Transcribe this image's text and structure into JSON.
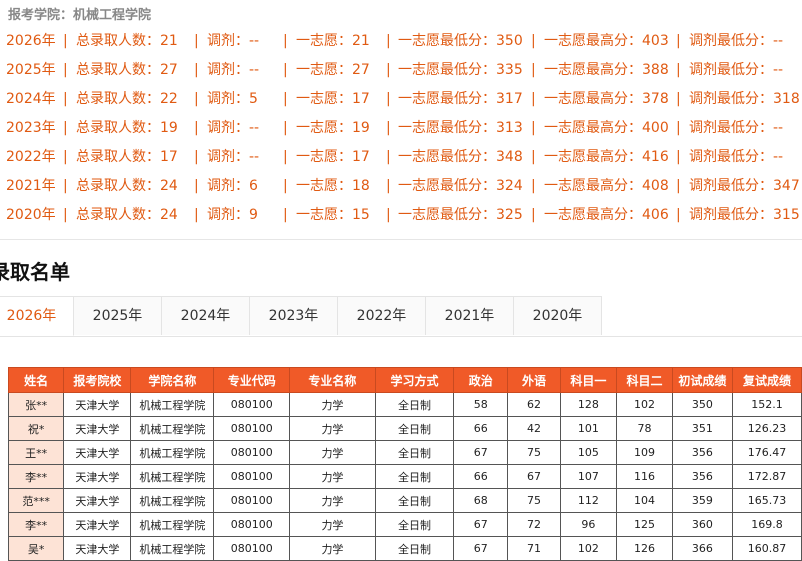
{
  "header": {
    "college_label": "报考学院：机械工程学院"
  },
  "stats_rows": [
    {
      "year": "2026年",
      "total": "总录取人数：21",
      "adjust": "调剂：--",
      "first": "一志愿：21",
      "first_min": "一志愿最低分：350",
      "first_max": "一志愿最高分：403",
      "adjust_min": "调剂最低分：--"
    },
    {
      "year": "2025年",
      "total": "总录取人数：27",
      "adjust": "调剂：--",
      "first": "一志愿：27",
      "first_min": "一志愿最低分：335",
      "first_max": "一志愿最高分：388",
      "adjust_min": "调剂最低分：--"
    },
    {
      "year": "2024年",
      "total": "总录取人数：22",
      "adjust": "调剂：5",
      "first": "一志愿：17",
      "first_min": "一志愿最低分：317",
      "first_max": "一志愿最高分：378",
      "adjust_min": "调剂最低分：318"
    },
    {
      "year": "2023年",
      "total": "总录取人数：19",
      "adjust": "调剂：--",
      "first": "一志愿：19",
      "first_min": "一志愿最低分：313",
      "first_max": "一志愿最高分：400",
      "adjust_min": "调剂最低分：--"
    },
    {
      "year": "2022年",
      "total": "总录取人数：17",
      "adjust": "调剂：--",
      "first": "一志愿：17",
      "first_min": "一志愿最低分：348",
      "first_max": "一志愿最高分：416",
      "adjust_min": "调剂最低分：--"
    },
    {
      "year": "2021年",
      "total": "总录取人数：24",
      "adjust": "调剂：6",
      "first": "一志愿：18",
      "first_min": "一志愿最低分：324",
      "first_max": "一志愿最高分：408",
      "adjust_min": "调剂最低分：347"
    },
    {
      "year": "2020年",
      "total": "总录取人数：24",
      "adjust": "调剂：9",
      "first": "一志愿：15",
      "first_min": "一志愿最低分：325",
      "first_max": "一志愿最高分：406",
      "adjust_min": "调剂最低分：315"
    }
  ],
  "separator": "|",
  "section": {
    "title": "录取名单"
  },
  "tabs": [
    "2026年",
    "2025年",
    "2024年",
    "2023年",
    "2022年",
    "2021年",
    "2020年"
  ],
  "active_tab": 0,
  "table": {
    "headers": [
      "姓名",
      "报考院校",
      "学院名称",
      "专业代码",
      "专业名称",
      "学习方式",
      "政治",
      "外语",
      "科目一",
      "科目二",
      "初试成绩",
      "复试成绩"
    ],
    "rows": [
      [
        "张**",
        "天津大学",
        "机械工程学院",
        "080100",
        "力学",
        "全日制",
        "58",
        "62",
        "128",
        "102",
        "350",
        "152.1"
      ],
      [
        "祝*",
        "天津大学",
        "机械工程学院",
        "080100",
        "力学",
        "全日制",
        "66",
        "42",
        "101",
        "78",
        "351",
        "126.23"
      ],
      [
        "王**",
        "天津大学",
        "机械工程学院",
        "080100",
        "力学",
        "全日制",
        "67",
        "75",
        "105",
        "109",
        "356",
        "176.47"
      ],
      [
        "李**",
        "天津大学",
        "机械工程学院",
        "080100",
        "力学",
        "全日制",
        "66",
        "67",
        "107",
        "116",
        "356",
        "172.87"
      ],
      [
        "范***",
        "天津大学",
        "机械工程学院",
        "080100",
        "力学",
        "全日制",
        "68",
        "75",
        "112",
        "104",
        "359",
        "165.73"
      ],
      [
        "李**",
        "天津大学",
        "机械工程学院",
        "080100",
        "力学",
        "全日制",
        "67",
        "72",
        "96",
        "125",
        "360",
        "169.8"
      ],
      [
        "吴*",
        "天津大学",
        "机械工程学院",
        "080100",
        "力学",
        "全日制",
        "67",
        "71",
        "102",
        "126",
        "366",
        "160.87"
      ]
    ]
  },
  "colors": {
    "accent": "#e05a12",
    "table_header": "#f05a28",
    "name_cell": "#fde3d6"
  }
}
